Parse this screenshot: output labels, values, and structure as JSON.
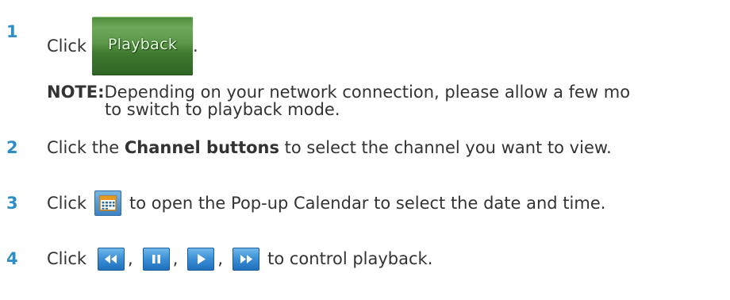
{
  "steps": [
    {
      "number": "1",
      "before": "Click",
      "button_text": "Playback",
      "after": "."
    },
    {
      "number": "2",
      "before": "Click the ",
      "bold": "Channel buttons",
      "after": " to select the channel you want to view."
    },
    {
      "number": "3",
      "before": "Click",
      "icon": "calendar-icon",
      "after": "to open the Pop-up Calendar to select the date and time."
    },
    {
      "number": "4",
      "before": "Click",
      "icons": [
        "rewind-icon",
        "pause-icon",
        "play-icon",
        "fast-forward-icon"
      ],
      "separator": ",",
      "after": "to control playback."
    }
  ],
  "note": {
    "label": "NOTE:",
    "line1": "Depending on your network connection, please allow a few mo",
    "line2": "to switch to playback mode."
  },
  "colors": {
    "step_number": "#2e8fc8",
    "text": "#333333",
    "playback_button": "#5c9849",
    "control_buttons": "#3b8fd6"
  }
}
